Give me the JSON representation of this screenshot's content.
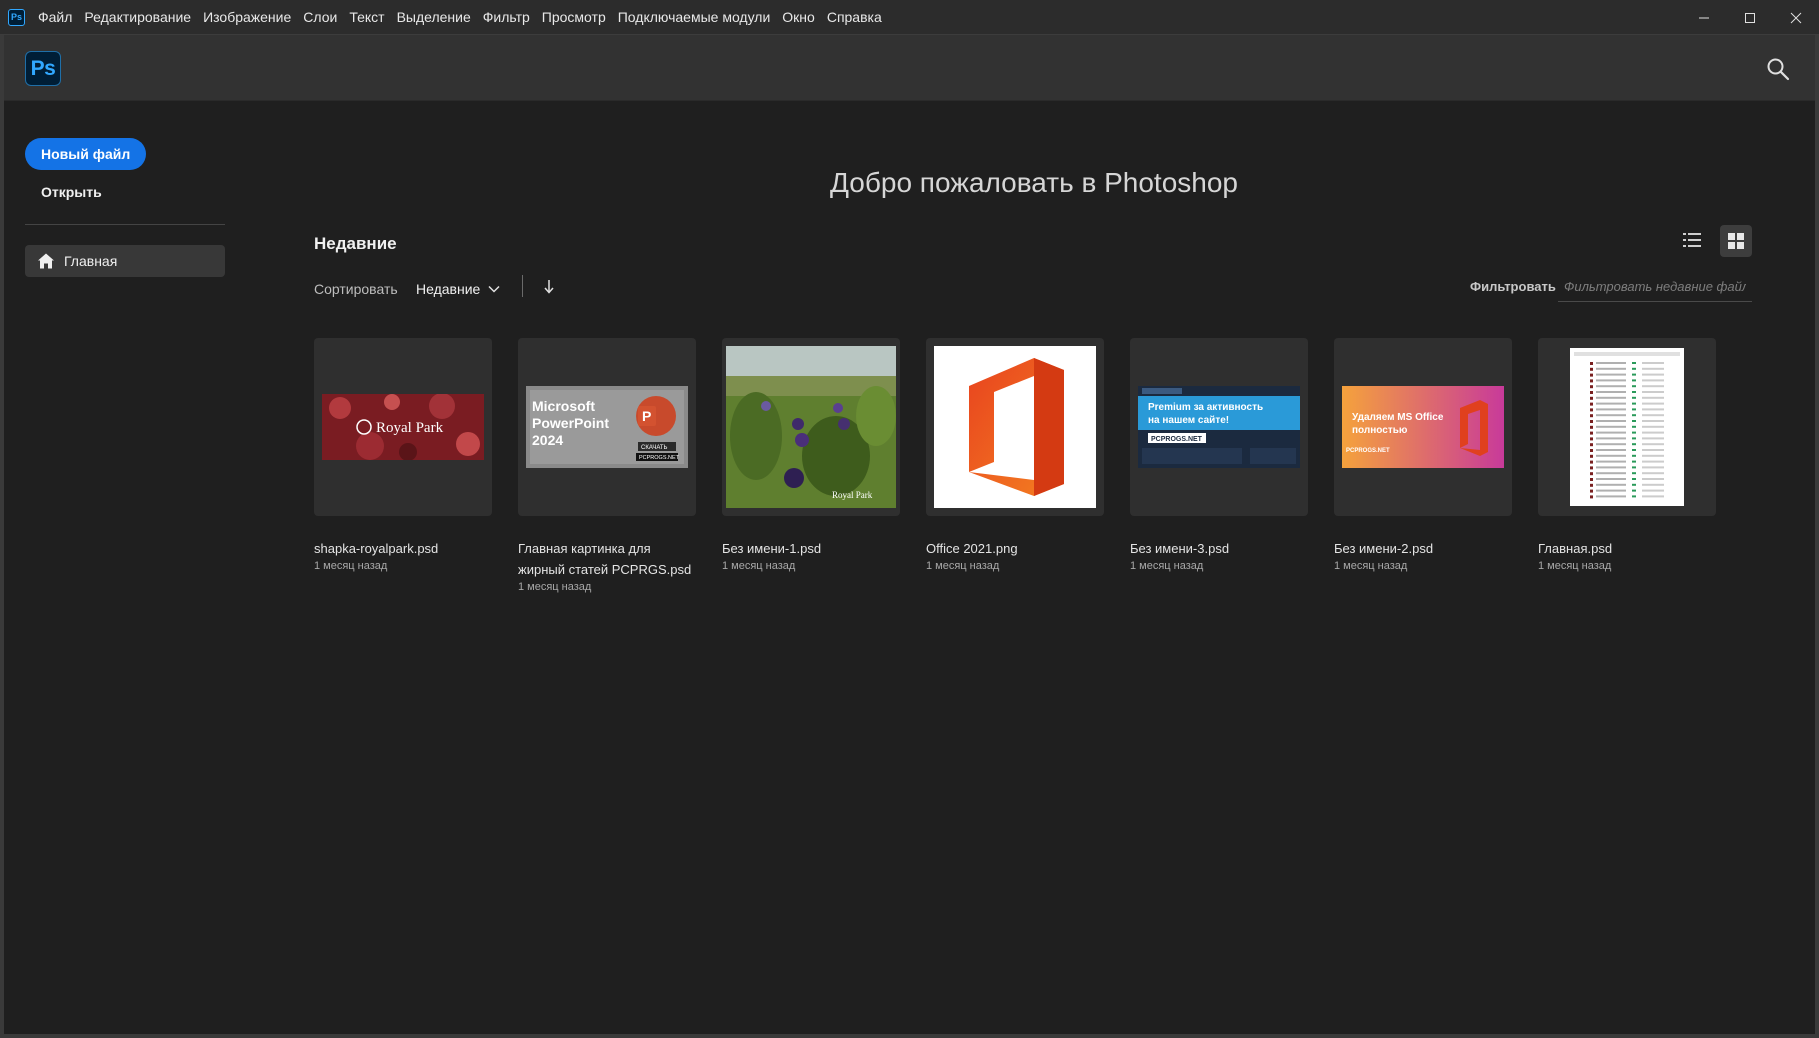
{
  "app": {
    "mini_icon": "Ps",
    "logo": "Ps"
  },
  "menu": [
    "Файл",
    "Редактирование",
    "Изображение",
    "Слои",
    "Текст",
    "Выделение",
    "Фильтр",
    "Просмотр",
    "Подключаемые модули",
    "Окно",
    "Справка"
  ],
  "window_controls": [
    "minimize-icon",
    "maximize-icon",
    "close-icon"
  ],
  "sidebar": {
    "new_file": "Новый файл",
    "open": "Открыть",
    "home": "Главная"
  },
  "main": {
    "welcome": "Добро пожаловать в Photoshop",
    "recent_title": "Недавние",
    "sort_label": "Сортировать",
    "sort_value": "Недавние",
    "filter_label": "Фильтровать",
    "filter_placeholder": "Фильтровать недавние файлы"
  },
  "recent_files": [
    {
      "name": "shapka-royalpark.psd",
      "date": "1 месяц назад",
      "thumb_text": "Royal Park",
      "colors": [
        "#7a1c22",
        "#b23a3e"
      ]
    },
    {
      "name": "Главная картинка для жирный статей PCPRGS.psd",
      "date": "1 месяц назад",
      "thumb_lines": [
        "Microsoft",
        "PowerPoint",
        "2024"
      ],
      "thumb_button": "СКАЧАТЬ",
      "thumb_site": "PCPROGS.NET",
      "colors": [
        "#8a8a8a",
        "#c84a2c"
      ]
    },
    {
      "name": "Без имени-1.psd",
      "date": "1 месяц назад",
      "thumb_text": "Royal Park",
      "colors": [
        "#5f7f2f",
        "#3f2a6a"
      ]
    },
    {
      "name": "Office 2021.png",
      "date": "1 месяц назад",
      "colors": [
        "#e03c22",
        "#f0801c"
      ]
    },
    {
      "name": "Без имени-3.psd",
      "date": "1 месяц назад",
      "thumb_lines": [
        "Premium за активность",
        "на нашем сайте!"
      ],
      "thumb_site": "PCPROGS.NET",
      "colors": [
        "#1b2a3f",
        "#2a9ad8"
      ]
    },
    {
      "name": "Без имени-2.psd",
      "date": "1 месяц назад",
      "thumb_lines": [
        "Удаляем MS Office",
        "полностью"
      ],
      "thumb_site": "PCPROGS.NET",
      "colors": [
        "#f5a23c",
        "#c83a9a"
      ]
    },
    {
      "name": "Главная.psd",
      "date": "1 месяц назад",
      "colors": [
        "#ffffff",
        "#2a9a5a"
      ]
    }
  ]
}
